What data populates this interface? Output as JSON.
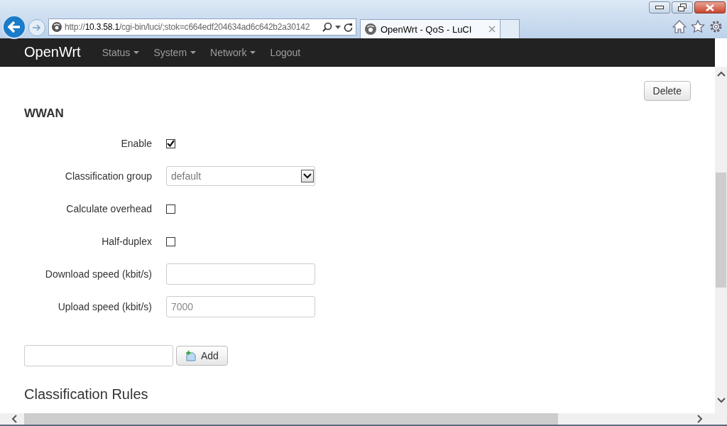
{
  "browser": {
    "address": "http://**10.3.58.1**/cgi-bin/luci/;stok=c664edf204634ad6c642b2a30142",
    "tabs": [
      {
        "title": "OpenWrt - QoS - LuCI",
        "selected": true
      }
    ]
  },
  "navbar": {
    "brand": "OpenWrt",
    "menu": [
      {
        "label": "Status",
        "dropdown": true
      },
      {
        "label": "System",
        "dropdown": true
      },
      {
        "label": "Network",
        "dropdown": true
      },
      {
        "label": "Logout",
        "dropdown": false
      }
    ]
  },
  "section": {
    "delete_button": "Delete",
    "title": "WWAN",
    "fields": [
      {
        "kind": "checkbox",
        "label": "Enable",
        "checked": true
      },
      {
        "kind": "select",
        "label": "Classification group",
        "value": "default"
      },
      {
        "kind": "checkbox",
        "label": "Calculate overhead",
        "checked": false
      },
      {
        "kind": "checkbox",
        "label": "Half-duplex",
        "checked": false
      },
      {
        "kind": "text",
        "label": "Download speed (kbit/s)"
      },
      {
        "kind": "text",
        "label": "Upload speed (kbit/s)",
        "placeholder": "7000"
      }
    ]
  },
  "add_row": {
    "button": "Add"
  },
  "next_section": {
    "title": "Classification Rules"
  }
}
